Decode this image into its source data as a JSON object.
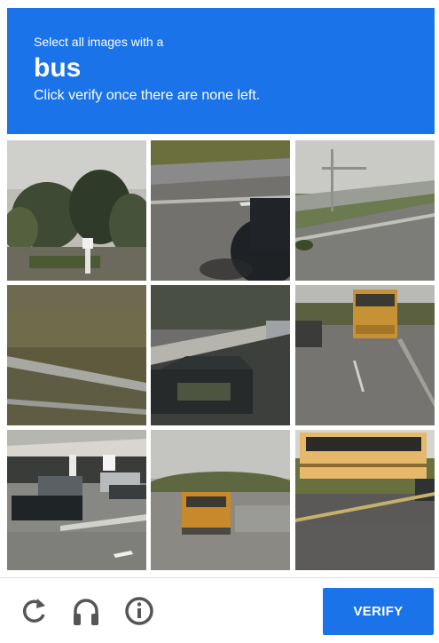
{
  "header": {
    "prompt_line": "Select all images with a",
    "target": "bus",
    "instructions": "Click verify once there are none left."
  },
  "tiles": [
    {
      "description": "street-trees"
    },
    {
      "description": "road-dark-car"
    },
    {
      "description": "highway-overpass"
    },
    {
      "description": "grass-guardrail"
    },
    {
      "description": "road-bridge-suv"
    },
    {
      "description": "road-school-bus"
    },
    {
      "description": "parking-cars"
    },
    {
      "description": "distant-school-bus"
    },
    {
      "description": "school-bus-road"
    }
  ],
  "footer": {
    "reload_icon": "reload-icon",
    "audio_icon": "headphones-icon",
    "info_icon": "info-icon",
    "verify_label": "VERIFY"
  },
  "colors": {
    "accent": "#1a73e8",
    "footer_icon": "#555555",
    "divider": "#e0e0e0"
  }
}
